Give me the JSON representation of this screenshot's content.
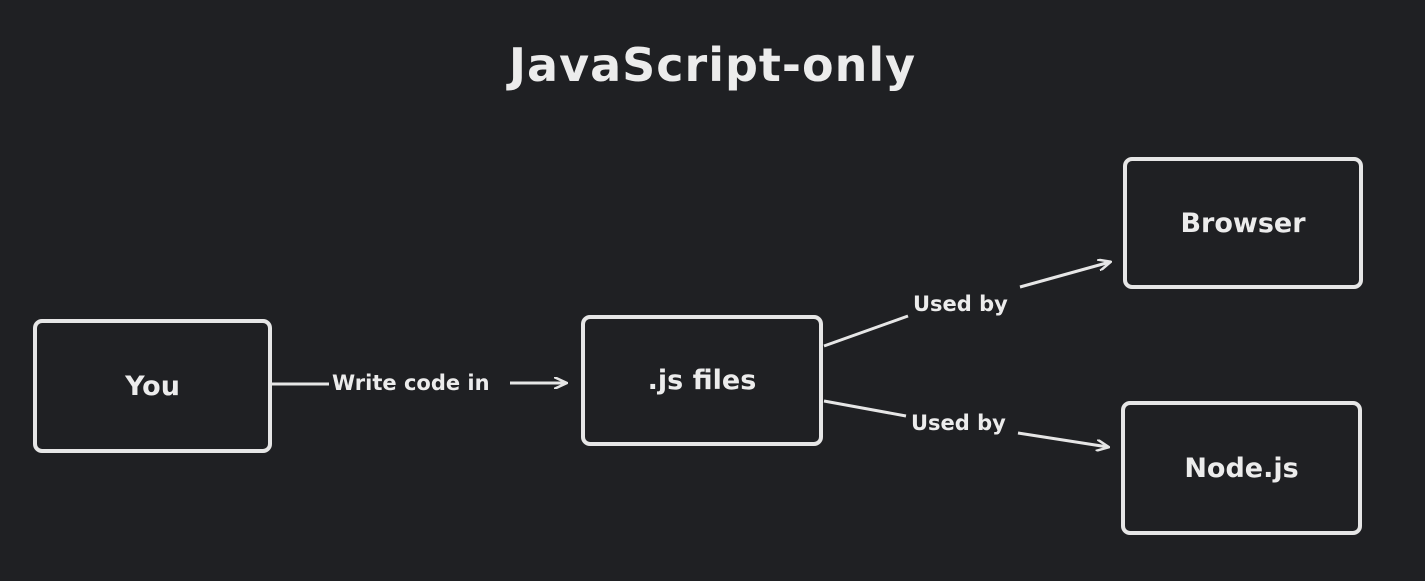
{
  "title": "JavaScript-only",
  "nodes": {
    "you": "You",
    "js_files": ".js files",
    "browser": "Browser",
    "nodejs": "Node.js"
  },
  "edges": {
    "you_to_js": "Write code in",
    "js_to_browser": "Used by",
    "js_to_nodejs": "Used by"
  },
  "colors": {
    "background": "#1f2023",
    "stroke": "#e6e6e6",
    "text": "#ececec"
  }
}
